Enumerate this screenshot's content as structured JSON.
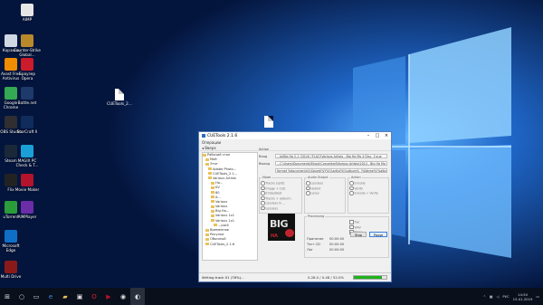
{
  "desktop": {
    "icons": [
      {
        "label": "AIMP",
        "color": "#e6e6e6"
      },
      {
        "label": "Корзина",
        "color": "#cfd8e3"
      },
      {
        "label": "Counter-Strike\nGlobal...",
        "color": "#b8892b"
      },
      {
        "label": "Avast Free\nAntivirus",
        "color": "#f08c00"
      },
      {
        "label": "Браузер\nOpera",
        "color": "#cc1b2a"
      },
      {
        "label": "Google\nChrome",
        "color": "#34a853"
      },
      {
        "label": "Battle.net",
        "color": "#1d3a6b"
      },
      {
        "label": "OBS Studio",
        "color": "#302e31"
      },
      {
        "label": "StarCraft II",
        "color": "#0f2c5c"
      },
      {
        "label": "Steam",
        "color": "#1b2838"
      },
      {
        "label": "MAGIX PC\nCheck & T...",
        "color": "#1aa0d6"
      },
      {
        "label": "Flix",
        "color": "#222"
      },
      {
        "label": "Movie Maker",
        "color": "#b3132b"
      },
      {
        "label": "uTorrent",
        "color": "#2a9d3a"
      },
      {
        "label": "AIMPlayer",
        "color": "#6b2da8"
      },
      {
        "label": "Microsoft\nEdge",
        "color": "#0f6fc6"
      },
      {
        "label": "Multi Drive",
        "color": "#8a1a1a"
      }
    ],
    "files": [
      {
        "label": "CUETools_2..."
      },
      {
        "label": ""
      }
    ]
  },
  "window": {
    "title": "CUETools 2.1.6",
    "menu": "Операции",
    "toolbar": "◂ Вверх",
    "tree": [
      "Рабочий стол",
      "Мой",
      "Этот",
      "Adobe Photo...",
      "CUETools_2.1...",
      "Various Artists",
      "Ho...",
      "KV",
      "60",
      "A...",
      "Various",
      "Various",
      "Big Ha...",
      "Various 1x1",
      "Various 1x1",
      "...pack",
      "Временное",
      "Рисунки",
      "Обычный",
      "CUETools_2.1.6"
    ],
    "labels": {
      "action": "Action",
      "input": "Вход",
      "output": "Выход",
      "mode": "Mode",
      "audio_output": "Audio Output",
      "action_group": "Action",
      "proc_group": "Processing"
    },
    "input_path": "...lo\\Big Ha 2-1 (2014) [FLAC]\\Various Artists - Big Ha Mo 4 Disc. 1\\cue",
    "output_path": "...C:\\Users\\Documents\\Music\\Converted\\Various Artists\\2014 - Big Ha Mo 4 Disc...",
    "output_template": "format %documents%\\Saved\\%Y%\\%artist%\\%album%_(%Name%\\%album%\\Vizer Template)",
    "mode_opts": [
      "Tracks (split)",
      "Image + CUE",
      "Embedded",
      "Tracks + (album)",
      "Lossless in ...",
      "Lossless"
    ],
    "output_opts": [
      "Lossless",
      "Hybrid",
      "Lossy"
    ],
    "action_opts": [
      "Encode",
      "Verify",
      "Encode + Verify"
    ],
    "proc_opts": [
      "flac",
      "WAV",
      "None"
    ],
    "fields": [
      "Принятие",
      "Тест СD",
      "Лог"
    ],
    "times": [
      "00:00:00",
      "00:00:00",
      "00:00:00"
    ],
    "cancel": "Stop",
    "go": "Pause",
    "status": "Writing track 01 (78%)...",
    "progress_info": "0.28.0 / 0.48 / 52.0%",
    "progress": 0.85
  },
  "taskbar": {
    "lang": "РУС",
    "time": "14:50",
    "date": "15.01.2019"
  },
  "cover": {
    "big": "BIG",
    "sub": "HA"
  }
}
